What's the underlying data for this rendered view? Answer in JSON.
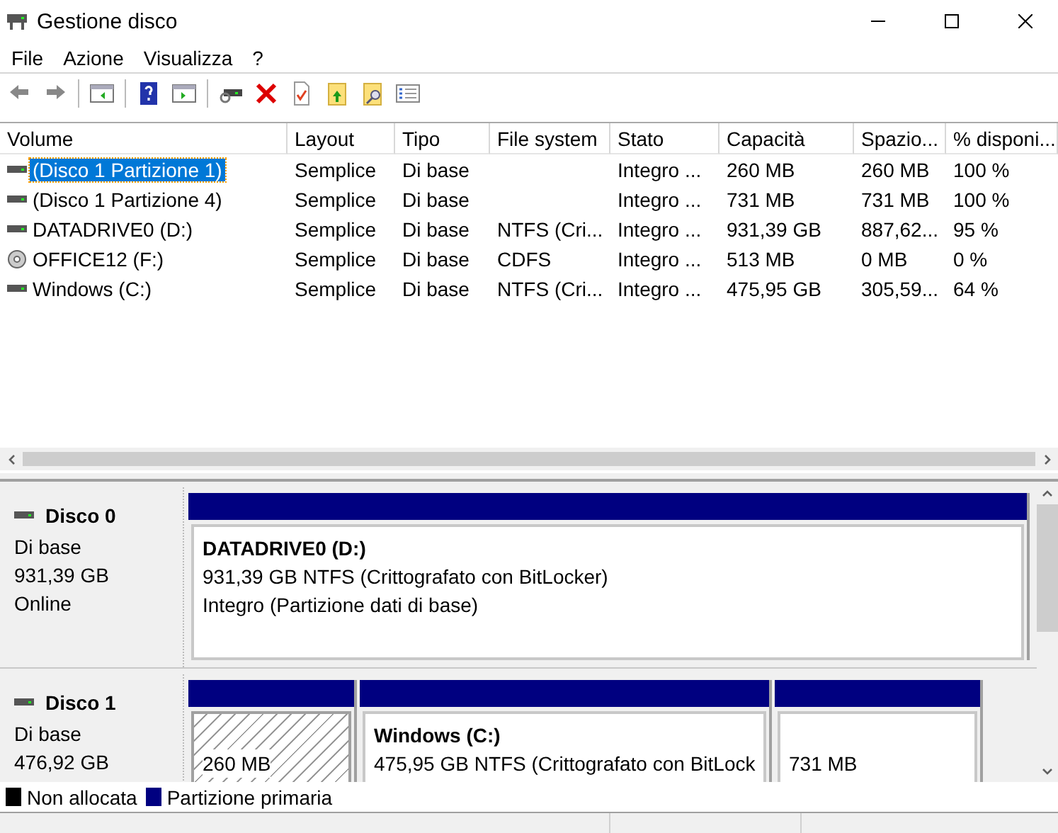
{
  "window": {
    "title": "Gestione disco"
  },
  "menu": [
    "File",
    "Azione",
    "Visualizza",
    "?"
  ],
  "table": {
    "columns": [
      "Volume",
      "Layout",
      "Tipo",
      "File system",
      "Stato",
      "Capacità",
      "Spazio...",
      "% disponi..."
    ],
    "rows": [
      {
        "kind": "disk",
        "selected": true,
        "cells": [
          "(Disco 1 Partizione 1)",
          "Semplice",
          "Di base",
          "",
          "Integro ...",
          "260 MB",
          "260 MB",
          "100 %"
        ]
      },
      {
        "kind": "disk",
        "selected": false,
        "cells": [
          "(Disco 1 Partizione 4)",
          "Semplice",
          "Di base",
          "",
          "Integro ...",
          "731 MB",
          "731 MB",
          "100 %"
        ]
      },
      {
        "kind": "disk",
        "selected": false,
        "cells": [
          "DATADRIVE0 (D:)",
          "Semplice",
          "Di base",
          "NTFS (Cri...",
          "Integro ...",
          "931,39 GB",
          "887,62...",
          "95 %"
        ]
      },
      {
        "kind": "cd",
        "selected": false,
        "cells": [
          "OFFICE12 (F:)",
          "Semplice",
          "Di base",
          "CDFS",
          "Integro ...",
          "513 MB",
          "0 MB",
          "0 %"
        ]
      },
      {
        "kind": "disk",
        "selected": false,
        "cells": [
          "Windows  (C:)",
          "Semplice",
          "Di base",
          "NTFS (Cri...",
          "Integro ...",
          "475,95 GB",
          "305,59...",
          "64 %"
        ]
      }
    ]
  },
  "disks": [
    {
      "name": "Disco 0",
      "lines": [
        "Di base",
        "931,39 GB",
        "Online"
      ],
      "partitions": [
        {
          "selected": false,
          "title": "DATADRIVE0  (D:)",
          "lines": [
            "931,39 GB NTFS (Crittografato con BitLocker)",
            "Integro (Partizione dati di base)"
          ]
        }
      ]
    },
    {
      "name": "Disco 1",
      "lines": [
        "Di base",
        "476,92 GB"
      ],
      "partitions": [
        {
          "selected": true,
          "lines": [
            "260 MB"
          ]
        },
        {
          "selected": false,
          "title": "Windows   (C:)",
          "lines": [
            "475,95 GB NTFS (Crittografato con BitLock"
          ]
        },
        {
          "selected": false,
          "lines": [
            "731 MB"
          ]
        }
      ]
    }
  ],
  "legend": [
    {
      "label": "Non allocata",
      "color": "#000000"
    },
    {
      "label": "Partizione primaria",
      "color": "#000080"
    }
  ]
}
